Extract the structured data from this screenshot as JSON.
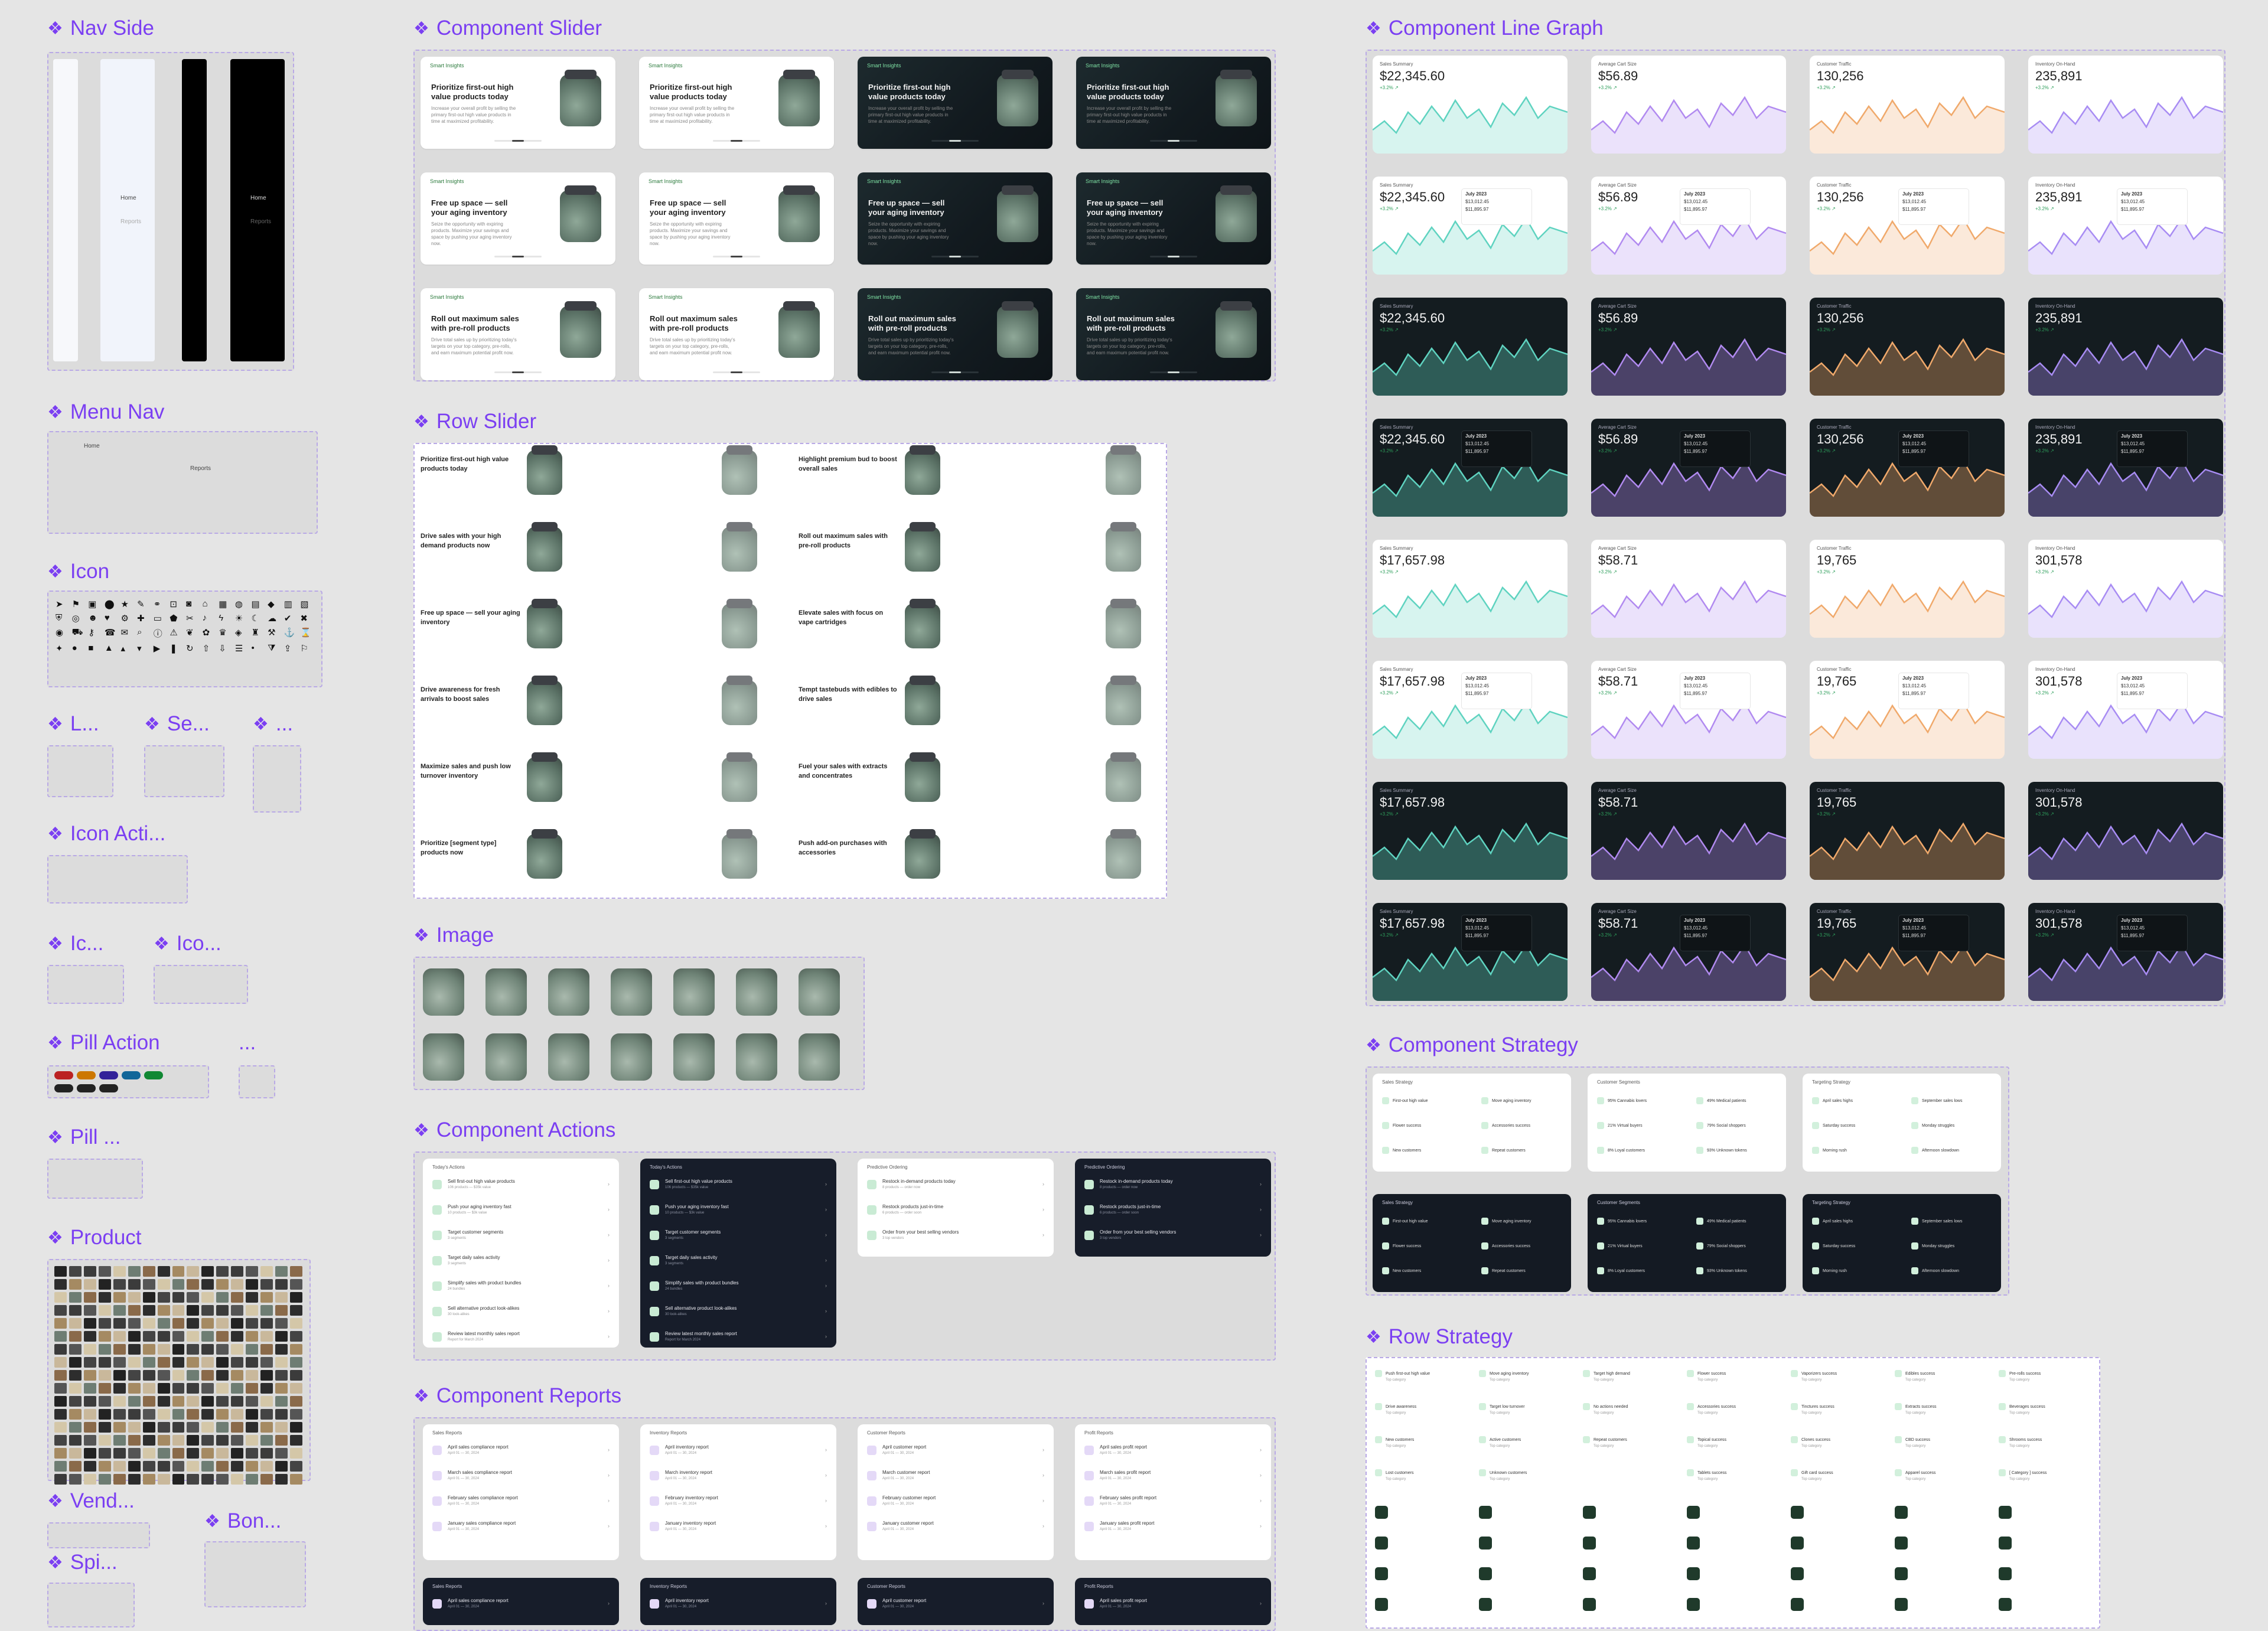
{
  "sections": {
    "nav_side": "Nav Side",
    "menu_nav": "Menu Nav",
    "icon": "Icon",
    "l": "L...",
    "se": "Se...",
    "dots": "...",
    "icon_acti": "Icon Acti...",
    "ic": "Ic...",
    "ico": "Ico...",
    "pill_action": "Pill Action",
    "pill_action_dots": "...",
    "pill": "Pill ...",
    "product": "Product",
    "vend": "Vend...",
    "bon": "Bon...",
    "spi": "Spi...",
    "component_slider": "Component Slider",
    "row_slider": "Row Slider",
    "image": "Image",
    "component_actions": "Component Actions",
    "component_reports": "Component Reports",
    "component_line_graph": "Component Line Graph",
    "component_strategy": "Component Strategy",
    "row_strategy": "Row Strategy"
  },
  "slider": {
    "tag": "Smart Insights",
    "rows": [
      {
        "title": "Prioritize first-out high value products today",
        "sub": "Increase your overall profit by selling the primary first-out high value products in time at maximized profitability."
      },
      {
        "title": "Free up space — sell your aging inventory",
        "sub": "Seize the opportunity with expiring products. Maximize your savings and space by pushing your aging inventory now."
      },
      {
        "title": "Roll out maximum sales with pre-roll products",
        "sub": "Drive total sales up by prioritizing today's targets on your top category, pre-rolls, and earn maximum potential profit now."
      }
    ]
  },
  "row_slider": {
    "left": [
      "Prioritize first-out high value products today",
      "Drive sales with your high demand products now",
      "Free up space — sell your aging inventory",
      "Drive awareness for fresh arrivals to boost sales",
      "Maximize sales and push low turnover inventory",
      "Prioritize [segment type] products now"
    ],
    "right": [
      "Highlight premium bud to boost overall sales",
      "Roll out maximum sales with pre-roll products",
      "Elevate sales with focus on vape cartridges",
      "Tempt tastebuds with edibles to drive sales",
      "Fuel your sales with extracts and concentrates",
      "Push add-on purchases with accessories"
    ]
  },
  "line_graph": {
    "cards": [
      {
        "label": "Sales Summary",
        "value": "$22,345.60",
        "change": "+3.2%",
        "color": "#5fd3c0"
      },
      {
        "label": "Average Cart Size",
        "value": "$56.89",
        "change": "+3.2%",
        "color": "#b18af0"
      },
      {
        "label": "Customer Traffic",
        "value": "130,256",
        "change": "+3.2%",
        "color": "#f0a96b"
      },
      {
        "label": "Inventory On-Hand",
        "value": "235,891",
        "change": "+3.2%",
        "color": "#a88cf3"
      }
    ],
    "cards_b": [
      {
        "label": "Sales Summary",
        "value": "$17,657.98",
        "change": "+3.2%",
        "color": "#5fd3c0"
      },
      {
        "label": "Average Cart Size",
        "value": "$58.71",
        "change": "+3.2%",
        "color": "#b18af0"
      },
      {
        "label": "Customer Traffic",
        "value": "19,765",
        "change": "+3.2%",
        "color": "#f0a96b"
      },
      {
        "label": "Inventory On-Hand",
        "value": "301,578",
        "change": "+3.2%",
        "color": "#a88cf3"
      }
    ],
    "tooltip": [
      "July 2023",
      "$13,012.45",
      "$11,895.97"
    ]
  },
  "actions": {
    "today_title": "Today's Actions",
    "predictive_title": "Predictive Ordering",
    "today_rows": [
      {
        "t": "Sell first-out high value products",
        "s": "106 products — $35k value"
      },
      {
        "t": "Push your aging inventory fast",
        "s": "10 products — $3k value"
      },
      {
        "t": "Target customer segments",
        "s": "3 segments"
      },
      {
        "t": "Target daily sales activity",
        "s": "3 segments"
      },
      {
        "t": "Simplify sales with product bundles",
        "s": "24 bundles"
      },
      {
        "t": "Sell alternative product look-alikes",
        "s": "30 look-alikes"
      },
      {
        "t": "Review latest monthly sales report",
        "s": "Report for March 2024"
      }
    ],
    "predictive_rows": [
      {
        "t": "Restock in-demand products today",
        "s": "8 products — order now"
      },
      {
        "t": "Restock products just-in-time",
        "s": "6 products — order soon"
      },
      {
        "t": "Order from your best selling vendors",
        "s": "3 top vendors"
      }
    ]
  },
  "reports": {
    "titles": [
      "Sales Reports",
      "Inventory Reports",
      "Customer Reports",
      "Profit Reports"
    ],
    "sales_rows": [
      "April sales compliance report",
      "March sales compliance report",
      "February sales compliance report",
      "January sales compliance report",
      "December sales compliance report"
    ],
    "inventory_rows": [
      "April inventory report",
      "March inventory report",
      "February inventory report",
      "January inventory report",
      "December inventory report"
    ],
    "customer_rows": [
      "April customer report",
      "March customer report",
      "February customer report",
      "January customer report",
      "December customer report"
    ],
    "profit_rows": [
      "April sales profit report",
      "March sales profit report",
      "February sales profit report",
      "January sales profit report",
      "December sales profit report"
    ],
    "date": "April 01 — 30, 2024"
  },
  "strategy": {
    "titles": [
      "Sales Strategy",
      "Customer Segments",
      "Targeting Strategy"
    ],
    "sales": [
      "First-out high value",
      "Move aging inventory",
      "Flower success",
      "Accessories success",
      "New customers",
      "Repeat customers"
    ],
    "segments": [
      "95% Cannabis lovers",
      "49% Medical patients",
      "21% Virtual buyers",
      "79% Social shoppers",
      "8% Loyal customers",
      "93% Unknown tokens"
    ],
    "targeting": [
      "April sales highs",
      "September sales lows",
      "Saturday success",
      "Monday struggles",
      "Morning rush",
      "Afternoon slowdown"
    ]
  },
  "row_strategy": {
    "items": [
      "Push first-out high value",
      "Move aging inventory",
      "Target high demand",
      "Flower success",
      "Vaporizers success",
      "Edibles success",
      "Pre-rolls success",
      "Drive awareness",
      "Target low turnover",
      "No actions needed",
      "Accessories success",
      "Tinctures success",
      "Extracts success",
      "Beverages success",
      "New customers",
      "Active customers",
      "Repeat customers",
      "Topical success",
      "Clones success",
      "CBD success",
      "Shrooms success",
      "Lost customers",
      "Unknown customers",
      "",
      "Tablets success",
      "Gift card success",
      "Apparel success",
      "[ Category ] success"
    ],
    "sub": "Top category"
  },
  "nav": {
    "home": "Home",
    "reports": "Reports"
  }
}
